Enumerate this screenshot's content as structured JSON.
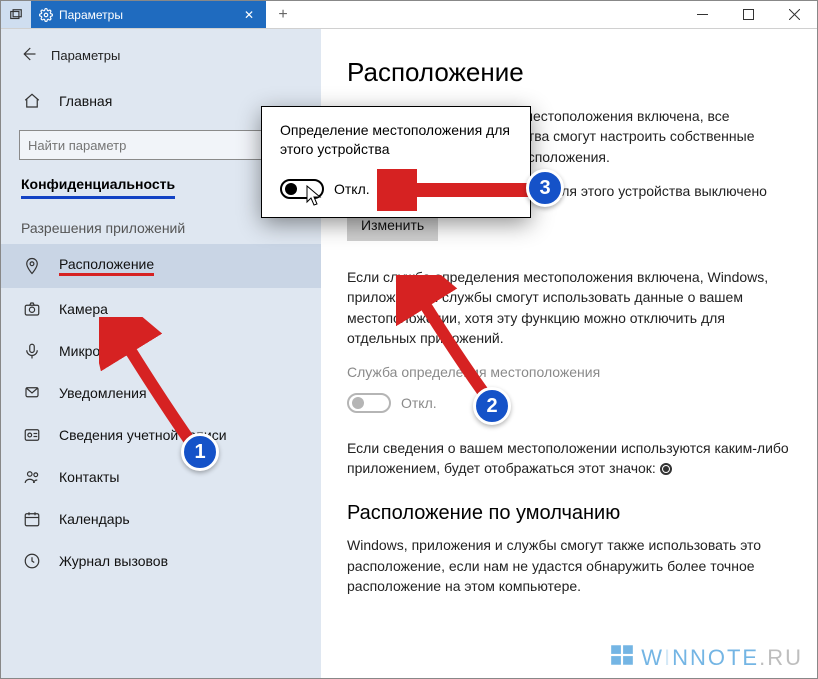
{
  "titlebar": {
    "tab_title": "Параметры",
    "newtab": "+"
  },
  "sidebar": {
    "back_label": "Параметры",
    "home": "Главная",
    "search_placeholder": "Найти параметр",
    "privacy": "Конфиденциальность",
    "permissions_header": "Разрешения приложений",
    "items": [
      {
        "label": "Расположение"
      },
      {
        "label": "Камера"
      },
      {
        "label": "Микрофон"
      },
      {
        "label": "Уведомления"
      },
      {
        "label": "Сведения учетной записи"
      },
      {
        "label": "Контакты"
      },
      {
        "label": "Календарь"
      },
      {
        "label": "Журнал вызовов"
      }
    ]
  },
  "main": {
    "heading": "Расположение",
    "para1": "Если служба определения местоположения включена, все пользователи этого устройства смогут настроить собственные параметры определения расположения.",
    "status": "Определение местоположения для этого устройства выключено",
    "change_btn": "Изменить",
    "para2": "Если служба определения местоположения включена, Windows, приложения и службы смогут использовать данные о вашем местоположении, хотя эту функцию можно отключить для отдельных приложений.",
    "service_label": "Служба определения местоположения",
    "service_state": "Откл.",
    "para3_a": "Если сведения о вашем местоположении используются каким-либо приложением, будет отображаться этот значок: ",
    "sub_heading": "Расположение по умолчанию",
    "para4": "Windows, приложения и службы смогут также использовать это расположение, если нам не удастся обнаружить более точное расположение на этом компьютере."
  },
  "popup": {
    "title": "Определение местоположения для этого устройства",
    "state": "Откл."
  },
  "annotations": {
    "n1": "1",
    "n2": "2",
    "n3": "3"
  },
  "watermark": {
    "text_a": "W",
    "text_b": "NNOTE",
    "text_c": "RU"
  }
}
